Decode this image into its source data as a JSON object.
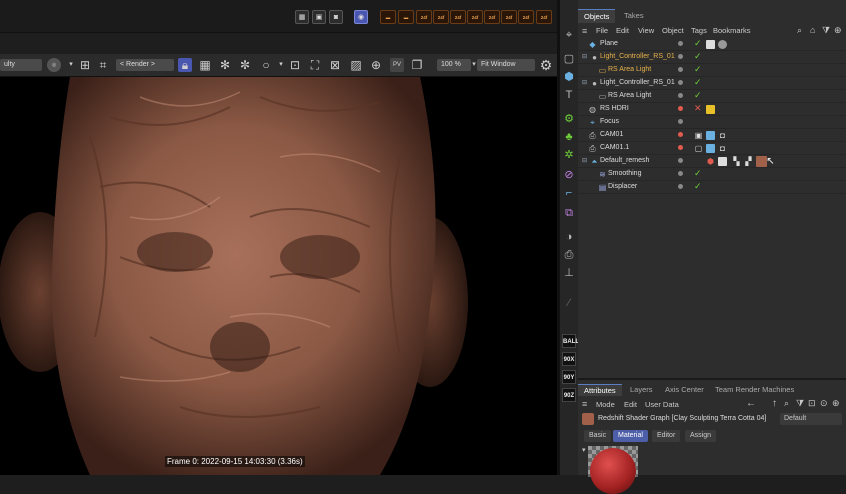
{
  "topbar": {
    "frame_buttons": [
      "24f",
      "24f",
      "24f",
      "24f",
      "24f",
      "24f",
      "24f",
      "24f"
    ]
  },
  "viewport_toolbar": {
    "left_dropdown": "ulty",
    "render_dropdown": "< Render >",
    "zoom_value": "100 %",
    "fit_dropdown": "Fit Window"
  },
  "viewport": {
    "frame_label": "Frame 0: 2022-09-15 14:03:30 (3.36s)"
  },
  "toolcolumn": {
    "labels": [
      "BALL",
      "90X",
      "90Y",
      "90Z"
    ]
  },
  "objects_panel": {
    "tabs": [
      "Objects",
      "Takes"
    ],
    "menu": [
      "File",
      "Edit",
      "View",
      "Object",
      "Tags",
      "Bookmarks"
    ],
    "rows": [
      {
        "name": "Plane",
        "indent": 0
      },
      {
        "name": "Light_Controller_RS_01",
        "indent": 0
      },
      {
        "name": "RS Area Light",
        "indent": 1
      },
      {
        "name": "Light_Controller_RS_01",
        "indent": 0
      },
      {
        "name": "RS Area Light",
        "indent": 1
      },
      {
        "name": "RS HDRI",
        "indent": 0
      },
      {
        "name": "Focus",
        "indent": 0
      },
      {
        "name": "CAM01",
        "indent": 0
      },
      {
        "name": "CAM01.1",
        "indent": 0
      },
      {
        "name": "Default_remesh",
        "indent": 0
      },
      {
        "name": "Smoothing",
        "indent": 1
      },
      {
        "name": "Displacer",
        "indent": 1
      }
    ]
  },
  "attributes_panel": {
    "tabs": [
      "Attributes",
      "Layers",
      "Axis Center",
      "Team Render Machines"
    ],
    "menu": [
      "Mode",
      "Edit",
      "User Data"
    ],
    "title": "Redshift Shader Graph [Clay Sculpting Terra Cotta 04]",
    "preset": "Default",
    "subtabs": [
      "Basic",
      "Material",
      "Editor",
      "Assign"
    ]
  },
  "colors": {
    "accent": "#5a7dc6",
    "check_green": "#6ecf3a",
    "cross_red": "#e25b4f",
    "orange_label": "#e8b24a"
  }
}
